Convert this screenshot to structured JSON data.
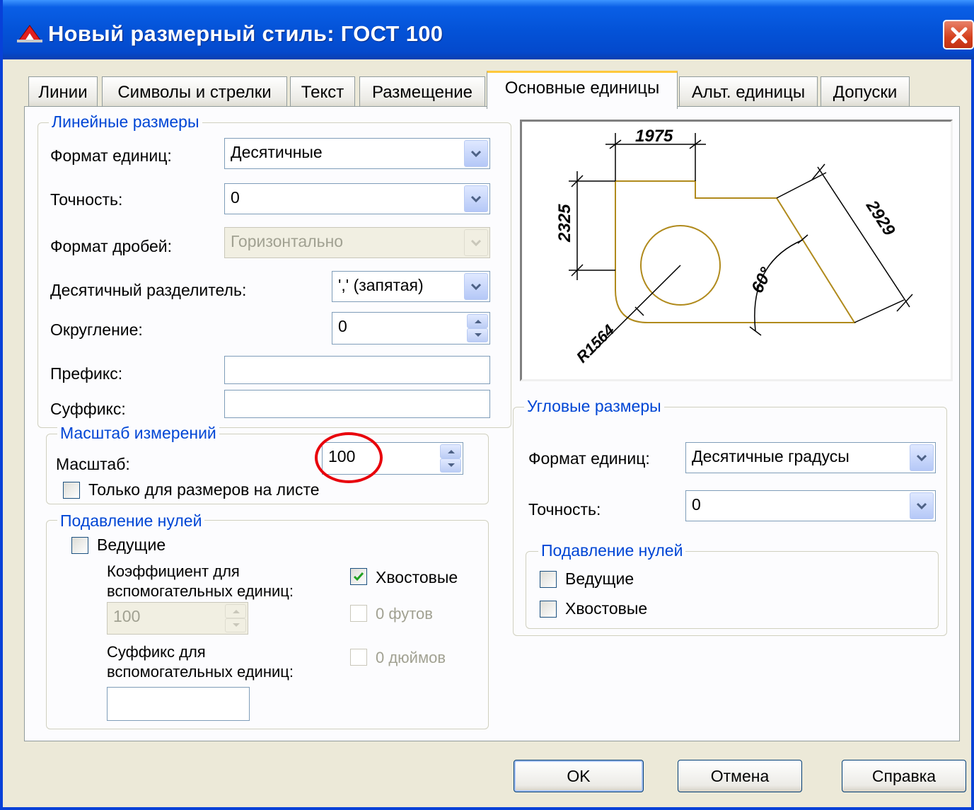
{
  "title": "Новый размерный стиль: ГОСТ 100",
  "icons": {
    "app": "autocad-icon",
    "close": "close-icon"
  },
  "tabs": [
    {
      "label": "Линии"
    },
    {
      "label": "Символы и стрелки"
    },
    {
      "label": "Текст"
    },
    {
      "label": "Размещение"
    },
    {
      "label": "Основные единицы",
      "active": true
    },
    {
      "label": "Альт. единицы"
    },
    {
      "label": "Допуски"
    }
  ],
  "linear": {
    "title": "Линейные размеры",
    "unit_format_label": "Формат единиц:",
    "unit_format_value": "Десятичные",
    "precision_label": "Точность:",
    "precision_value": "0",
    "fraction_label": "Формат дробей:",
    "fraction_value": "Горизонтально",
    "decimal_sep_label": "Десятичный  разделитель:",
    "decimal_sep_value": "',' (запятая)",
    "round_label": "Округление:",
    "round_value": "0",
    "prefix_label": "Префикс:",
    "prefix_value": "",
    "suffix_label": "Суффикс:",
    "suffix_value": ""
  },
  "scale": {
    "title": "Масштаб измерений",
    "scale_label": "Масштаб:",
    "scale_value": "100",
    "layout_only_label": "Только для размеров на листе",
    "layout_only_checked": false
  },
  "zero_linear": {
    "title": "Подавление нулей",
    "leading_label": "Ведущие",
    "leading_checked": false,
    "sub_factor_label_1": "Коэффициент для",
    "sub_factor_label_2": "вспомогательных единиц:",
    "sub_factor_value": "100",
    "sub_suffix_label_1": "Суффикс для",
    "sub_suffix_label_2": "вспомогательных единиц:",
    "sub_suffix_value": "",
    "trailing_label": "Хвостовые",
    "trailing_checked": true,
    "feet_label": "0 футов",
    "inches_label": "0 дюймов"
  },
  "preview": {
    "dim_top": "1975",
    "dim_left": "2325",
    "dim_diag": "2929",
    "dim_angle": "60°",
    "dim_radius": "R1564"
  },
  "angular": {
    "title": "Угловые размеры",
    "unit_format_label": "Формат единиц:",
    "unit_format_value": "Десятичные градусы",
    "precision_label": "Точность:",
    "precision_value": "0"
  },
  "zero_angular": {
    "title": "Подавление нулей",
    "leading_label": "Ведущие",
    "leading_checked": false,
    "trailing_label": "Хвостовые",
    "trailing_checked": false
  },
  "buttons": {
    "ok": "OK",
    "cancel": "Отмена",
    "help": "Справка"
  },
  "colors": {
    "title_bar": "#0453d8",
    "accent_tab": "#ffc83c",
    "group_title": "#0046d5",
    "highlight_circle": "#e8000b",
    "drawing_line": "#b08a1c"
  }
}
